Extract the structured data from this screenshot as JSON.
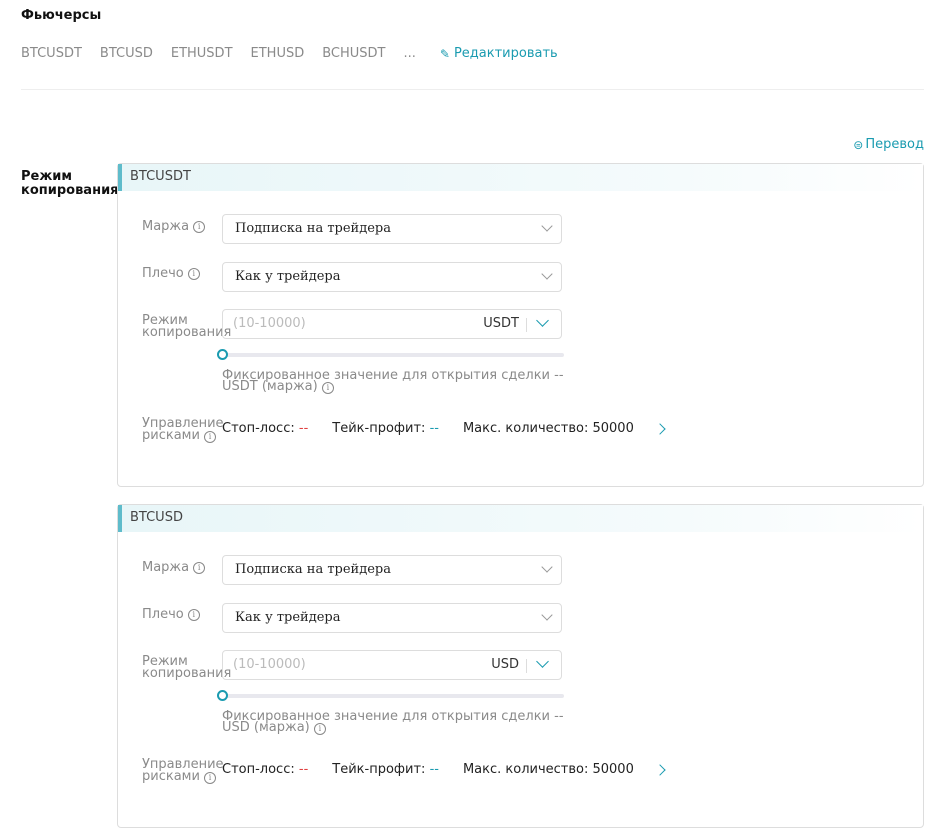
{
  "title": "Фьючерсы",
  "tabs": [
    "BTCUSDT",
    "BTCUSD",
    "ETHUSDT",
    "ETHUSD",
    "BCHUSDT",
    "..."
  ],
  "edit_label": "Редактировать",
  "transfer_label": "Перевод",
  "mode_label_1": "Режим",
  "mode_label_2": "копирования",
  "cards": [
    {
      "symbol": "BTCUSDT",
      "margin_label": "Маржа",
      "margin_value": "Подписка на трейдера",
      "leverage_label": "Плечо",
      "leverage_value": "Как у трейдера",
      "copy_label_1": "Режим",
      "copy_label_2": "копирования",
      "amount_placeholder": "(10-10000)",
      "currency": "USDT",
      "slider_value": 0,
      "hint_1": "Фиксированное значение для открытия сделки --",
      "hint_2": "USDT (маржа)",
      "risk_label_1": "Управление",
      "risk_label_2": "рисками",
      "stop_loss_label": "Стоп-лосс:",
      "stop_loss_value": "--",
      "take_profit_label": "Тейк-профит:",
      "take_profit_value": "--",
      "max_qty": "Макс. количество: 50000"
    },
    {
      "symbol": "BTCUSD",
      "margin_label": "Маржа",
      "margin_value": "Подписка на трейдера",
      "leverage_label": "Плечо",
      "leverage_value": "Как у трейдера",
      "copy_label_1": "Режим",
      "copy_label_2": "копирования",
      "amount_placeholder": "(10-10000)",
      "currency": "USD",
      "slider_value": 0,
      "hint_1": "Фиксированное значение для открытия сделки --",
      "hint_2": "USD (маржа)",
      "risk_label_1": "Управление",
      "risk_label_2": "рисками",
      "stop_loss_label": "Стоп-лосс:",
      "stop_loss_value": "--",
      "take_profit_label": "Тейк-профит:",
      "take_profit_value": "--",
      "max_qty": "Макс. количество: 50000"
    }
  ]
}
